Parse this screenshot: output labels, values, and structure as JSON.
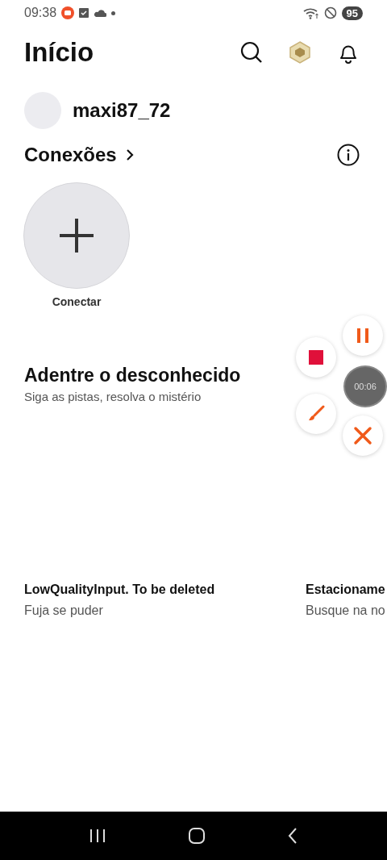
{
  "status_bar": {
    "time": "09:38",
    "battery": "95"
  },
  "header": {
    "title": "Início"
  },
  "profile": {
    "username": "maxi87_72"
  },
  "connections": {
    "title": "Conexões",
    "connect_label": "Conectar"
  },
  "section": {
    "title": "Adentre o desconhecido",
    "subtitle": "Siga as pistas, resolva o mistério"
  },
  "games": [
    {
      "title": "LowQualityInput. To be deleted",
      "subtitle": "Fuja se puder"
    },
    {
      "title": "Estacioname",
      "subtitle": "Busque na no"
    }
  ],
  "recorder": {
    "timer": "00:06"
  }
}
